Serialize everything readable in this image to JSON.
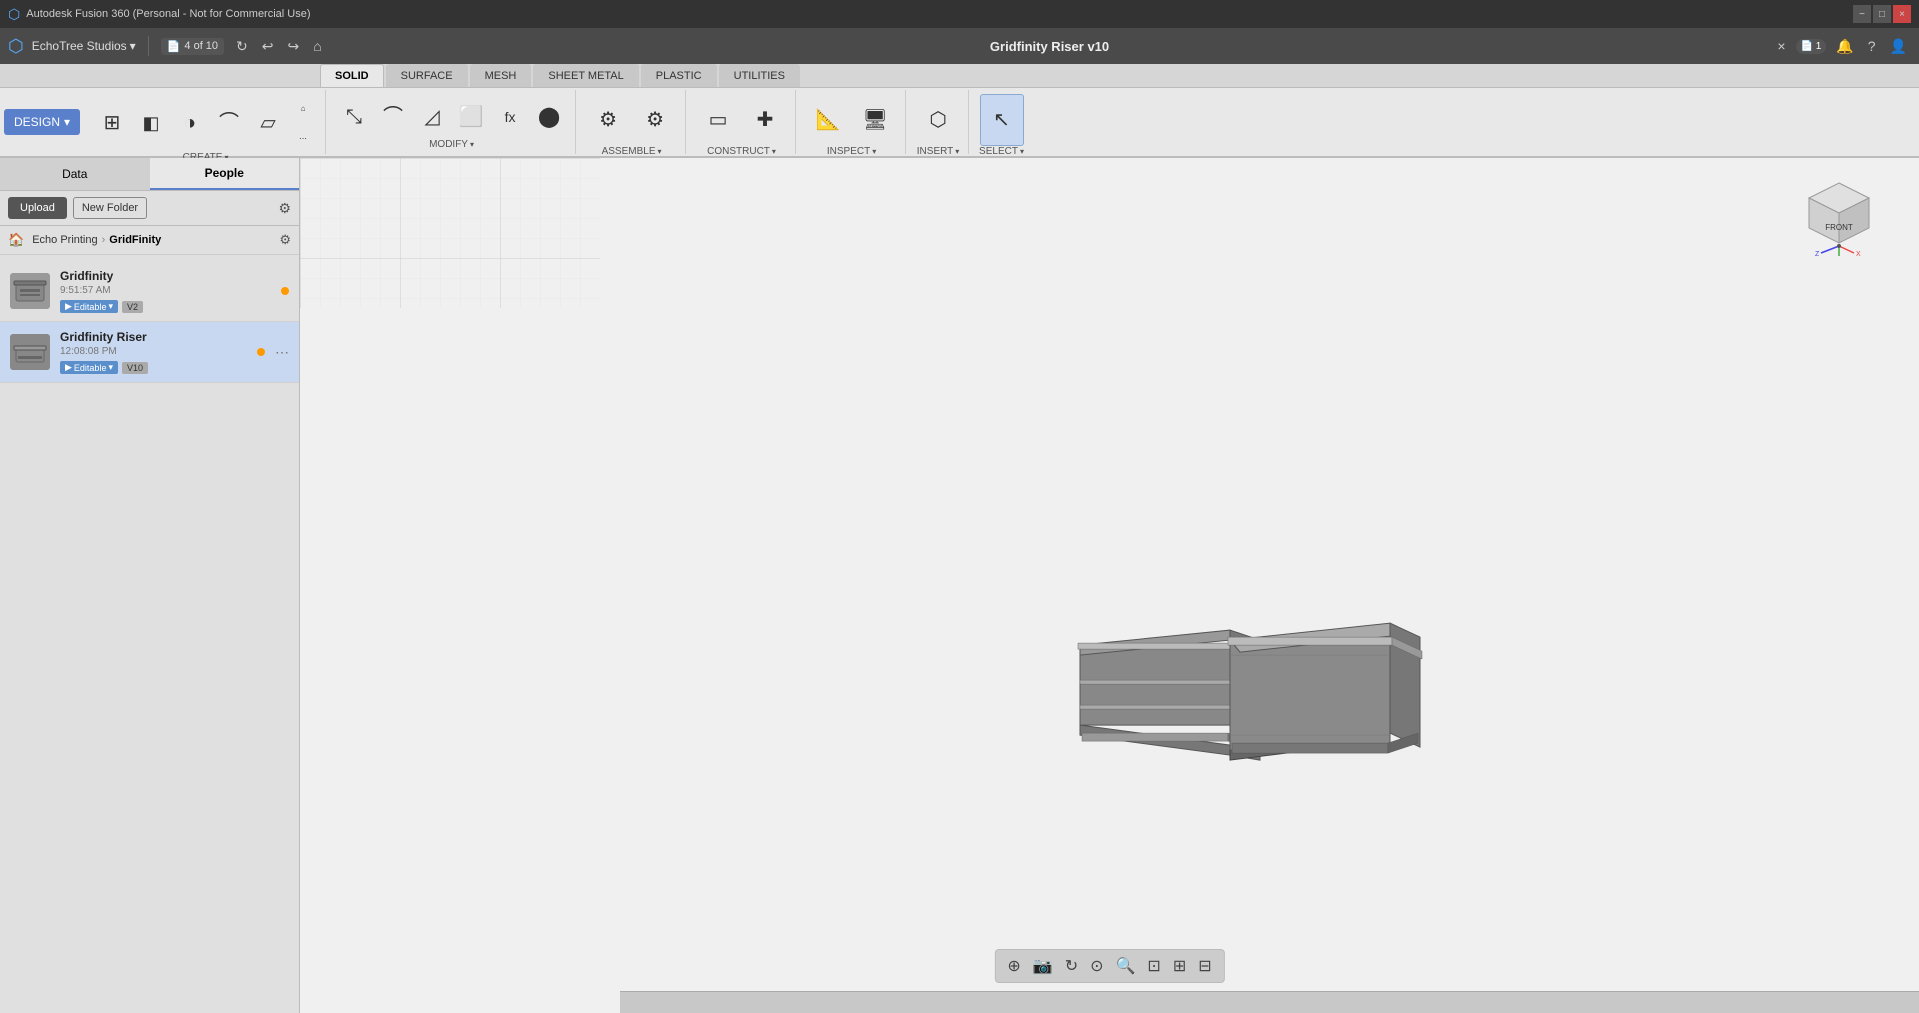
{
  "titlebar": {
    "title": "Autodesk Fusion 360 (Personal - Not for Commercial Use)",
    "minimize": "−",
    "maximize": "□",
    "close": "×"
  },
  "topnav": {
    "logo": "⬡",
    "studio": "EchoTree Studios",
    "studio_dropdown": "▾",
    "file_icon": "📄",
    "file_count": "4 of 10",
    "undo": "↩",
    "redo": "↪",
    "home": "⌂",
    "grid_icon": "⊞",
    "doc_title": "Gridfinity Riser v10",
    "close_doc": "×",
    "notifications": "🔔",
    "question": "?",
    "account": "👤",
    "search": "🔍",
    "file_count_badge": "1"
  },
  "ribbon_tabs": [
    {
      "id": "solid",
      "label": "SOLID",
      "active": true
    },
    {
      "id": "surface",
      "label": "SURFACE",
      "active": false
    },
    {
      "id": "mesh",
      "label": "MESH",
      "active": false
    },
    {
      "id": "sheet_metal",
      "label": "SHEET METAL",
      "active": false
    },
    {
      "id": "plastic",
      "label": "PLASTIC",
      "active": false
    },
    {
      "id": "utilities",
      "label": "UTILITIES",
      "active": false
    }
  ],
  "ribbon": {
    "design_label": "DESIGN",
    "groups": [
      {
        "id": "create",
        "label": "CREATE",
        "tools": [
          {
            "id": "new-component",
            "icon": "⊞",
            "label": ""
          },
          {
            "id": "extrude",
            "icon": "◧",
            "label": ""
          },
          {
            "id": "revolve",
            "icon": "◑",
            "label": ""
          },
          {
            "id": "sweep",
            "icon": "⌒",
            "label": ""
          },
          {
            "id": "loft",
            "icon": "▱",
            "label": ""
          },
          {
            "id": "pattern",
            "icon": "⌂",
            "label": ""
          }
        ]
      },
      {
        "id": "modify",
        "label": "MODIFY",
        "tools": [
          {
            "id": "press-pull",
            "icon": "⤡",
            "label": ""
          },
          {
            "id": "fillet",
            "icon": "⌒",
            "label": ""
          },
          {
            "id": "chamfer",
            "icon": "◿",
            "label": ""
          },
          {
            "id": "shell",
            "icon": "⬜",
            "label": ""
          },
          {
            "id": "fx",
            "icon": "fx",
            "label": ""
          },
          {
            "id": "sphere",
            "icon": "⬤",
            "label": ""
          }
        ]
      },
      {
        "id": "assemble",
        "label": "ASSEMBLE",
        "tools": [
          {
            "id": "joint",
            "icon": "⚙",
            "label": ""
          },
          {
            "id": "as-built",
            "icon": "⚙",
            "label": ""
          }
        ]
      },
      {
        "id": "construct",
        "label": "CONSTRUCT",
        "tools": [
          {
            "id": "plane",
            "icon": "▭",
            "label": ""
          },
          {
            "id": "axis",
            "icon": "✚",
            "label": ""
          }
        ]
      },
      {
        "id": "inspect",
        "label": "INSPECT",
        "tools": [
          {
            "id": "measure",
            "icon": "⬡",
            "label": ""
          },
          {
            "id": "display",
            "icon": "🖥",
            "label": ""
          }
        ]
      },
      {
        "id": "insert",
        "label": "INSERT",
        "tools": [
          {
            "id": "insert-mesh",
            "icon": "⬡",
            "label": ""
          }
        ]
      },
      {
        "id": "select",
        "label": "SELECT",
        "tools": [
          {
            "id": "select-tool",
            "icon": "↖",
            "label": ""
          }
        ]
      }
    ]
  },
  "left_panel": {
    "tabs": [
      {
        "id": "data",
        "label": "Data",
        "active": false
      },
      {
        "id": "people",
        "label": "People",
        "active": true
      }
    ],
    "upload_label": "Upload",
    "new_folder_label": "New Folder",
    "breadcrumb": {
      "home": "🏠",
      "items": [
        "Echo Printing",
        "GridFinity"
      ],
      "settings": "⚙"
    },
    "files": [
      {
        "id": "gridfinity",
        "name": "Gridfinity",
        "time": "9:51:57 AM",
        "tag": "Editable",
        "version": "V2",
        "status": "orange"
      },
      {
        "id": "gridfinity-riser",
        "name": "Gridfinity Riser",
        "time": "12:08:08 PM",
        "tag": "Editable",
        "version": "V10",
        "status": "orange",
        "active": true
      }
    ]
  },
  "viewport": {
    "bottom_tools": [
      "⊕",
      "📷",
      "↻",
      "⊙",
      "🔍",
      "⊡",
      "⊞",
      "⊟"
    ]
  },
  "status_bar": {
    "text": ""
  }
}
